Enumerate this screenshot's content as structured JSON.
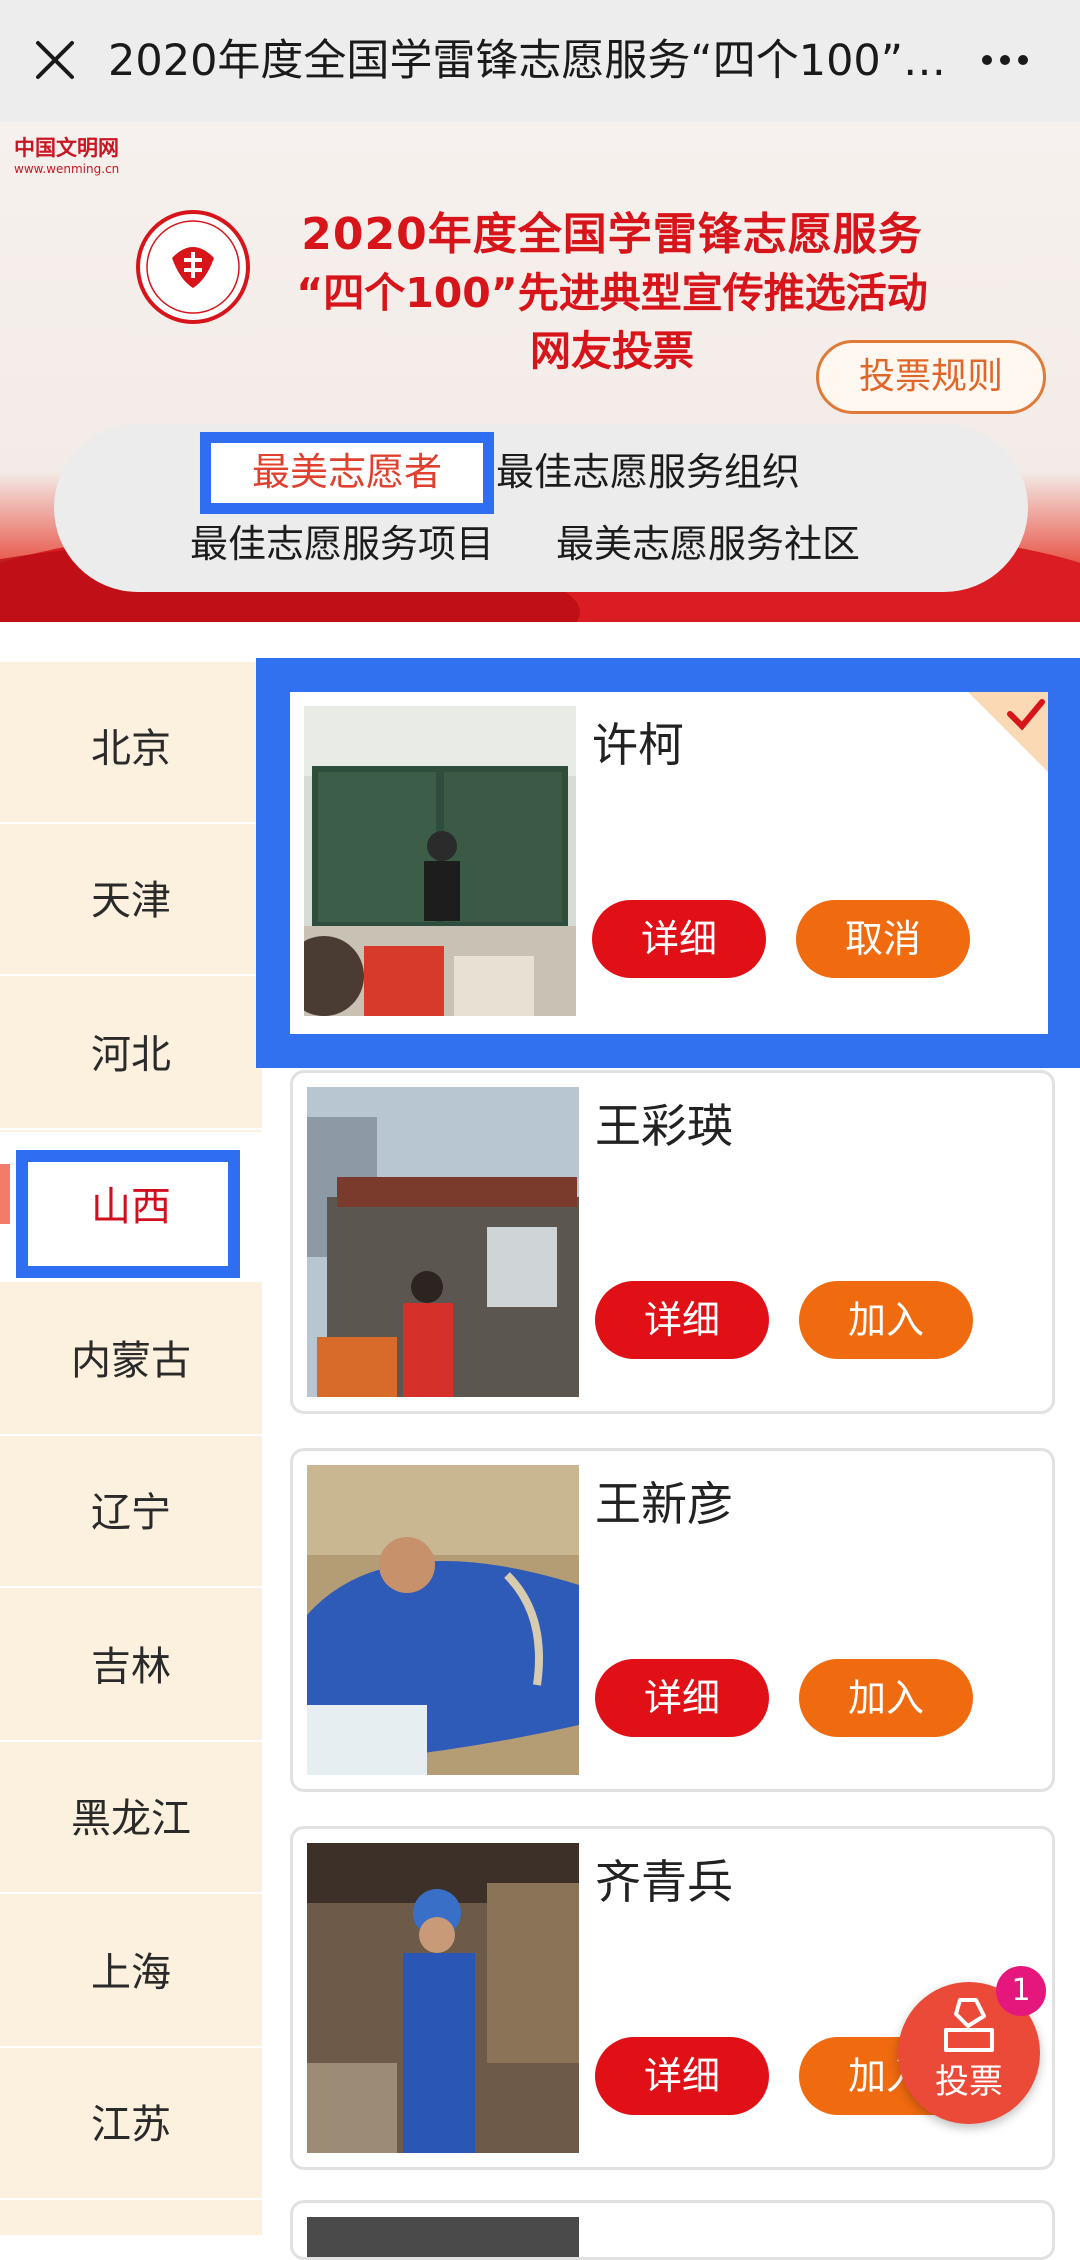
{
  "topbar": {
    "title": "2020年度全国学雷锋志愿服务“四个100”…"
  },
  "banner": {
    "site_logo_cn": "中国文明网",
    "site_logo_en": "www.wenming.cn",
    "headline_line1": "2020年度全国学雷锋志愿服务",
    "headline_line2": "“四个100”先进典型宣传推选活动",
    "headline_line3": "网友投票",
    "rules_label": "投票规则"
  },
  "categories": [
    {
      "label": "最美志愿者",
      "active": true
    },
    {
      "label": "最佳志愿服务组织",
      "active": false
    },
    {
      "label": "最佳志愿服务项目",
      "active": false
    },
    {
      "label": "最美志愿服务社区",
      "active": false
    }
  ],
  "provinces": [
    "北京",
    "天津",
    "河北",
    "山西",
    "内蒙古",
    "辽宁",
    "吉林",
    "黑龙江",
    "上海",
    "江苏"
  ],
  "active_province": "山西",
  "candidates": [
    {
      "name": "许柯",
      "detail_label": "详细",
      "action_label": "取消",
      "selected": true
    },
    {
      "name": "王彩瑛",
      "detail_label": "详细",
      "action_label": "加入",
      "selected": false
    },
    {
      "name": "王新彦",
      "detail_label": "详细",
      "action_label": "加入",
      "selected": false
    },
    {
      "name": "齐青兵",
      "detail_label": "详细",
      "action_label": "加入",
      "selected": false
    }
  ],
  "vote_fab": {
    "label": "投票",
    "count": "1"
  },
  "colors": {
    "brand_red": "#e10f16",
    "action_orange": "#f06a10",
    "highlight_blue": "#2f6ef0",
    "sidebar_bg": "#fbf1de"
  }
}
